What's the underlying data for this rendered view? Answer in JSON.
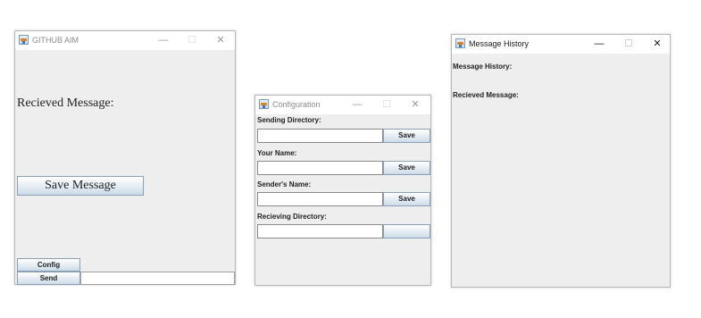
{
  "github_aim_window": {
    "title": "GITHUB AIM",
    "received_label": "Recieved Message:",
    "save_message_label": "Save Message",
    "config_label": "Config",
    "send_label": "Send",
    "message_input_value": "",
    "controls": {
      "minimize": "—",
      "maximize": "☐",
      "close": "✕"
    }
  },
  "configuration_window": {
    "title": "Configuration",
    "sending_directory_label": "Sending Directory:",
    "sending_directory_value": "",
    "sending_directory_save": "Save",
    "your_name_label": "Your Name:",
    "your_name_value": "",
    "your_name_save": "Save",
    "senders_name_label": "Sender's Name:",
    "senders_name_value": "",
    "senders_name_save": "Save",
    "receiving_directory_label": "Recieving Directory:",
    "receiving_directory_value": "",
    "receiving_directory_button": "",
    "controls": {
      "minimize": "—",
      "maximize": "☐",
      "close": "✕"
    }
  },
  "message_history_window": {
    "title": "Message History",
    "history_label": "Message History:",
    "received_label": "Recieved Message:",
    "controls": {
      "minimize": "—",
      "maximize": "☐",
      "close": "✕"
    }
  },
  "colors": {
    "window_bg": "#eeeeee",
    "titlebar_bg": "#ffffff",
    "inactive_title": "#8c8c8c",
    "active_title": "#1a1a1a",
    "button_border": "#8aa0b7"
  },
  "icons": [
    "java-app-icon",
    "minimize-icon",
    "maximize-icon",
    "close-icon"
  ]
}
